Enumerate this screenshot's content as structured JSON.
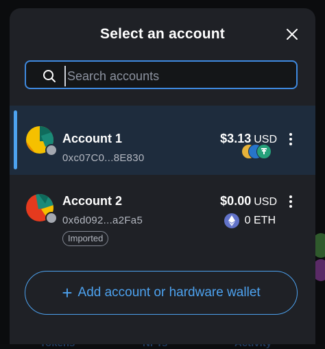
{
  "modal": {
    "title": "Select an account",
    "search_placeholder": "Search accounts",
    "add_button_label": "Add account or hardware wallet"
  },
  "accounts": [
    {
      "name": "Account 1",
      "address": "0xc07C0...8E830",
      "balance": "$3.13",
      "currency": "USD",
      "selected": true
    },
    {
      "name": "Account 2",
      "address": "0x6d092...a2Fa5",
      "balance": "$0.00",
      "currency": "USD",
      "token_amount": "0 ETH",
      "badge": "Imported",
      "selected": false
    }
  ],
  "background_tabs": [
    "Tokens",
    "NFTs",
    "Activity"
  ],
  "colors": {
    "accent": "#4da2ef",
    "modal_bg": "#1f2126",
    "selected_row": "#1e2c3d",
    "search_border": "#3f8ae0"
  },
  "icons": [
    "search-icon",
    "close-icon",
    "kebab-menu-icon",
    "usdc-token-icon",
    "tether-token-icon",
    "eth-token-icon",
    "plus-icon"
  ]
}
